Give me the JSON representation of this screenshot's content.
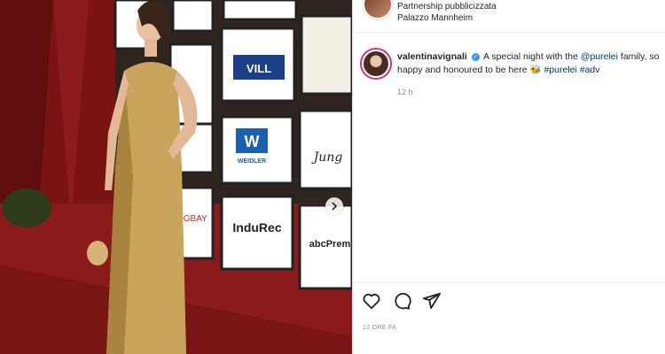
{
  "header": {
    "partnership": "Partnership pubblicizzata",
    "location": "Palazzo Mannheim"
  },
  "post": {
    "username": "valentinavignali",
    "caption_line1_text": "A special night with the",
    "caption_mention": "@purelei",
    "caption_line1_end": "family, so",
    "caption_line2_text": "happy and honoured to be here 🐝",
    "hashtag1": "#purelei",
    "hashtag2": "#adv",
    "relative_time": "12 h",
    "timestamp": "12 ORE FA"
  },
  "media": {
    "sponsor_boards": [
      "VILL",
      "WEIDLER",
      "InduRec",
      "abcPrem",
      "GIGBAY",
      "Jung"
    ]
  },
  "icons": {
    "like": "heart-icon",
    "comment": "comment-icon",
    "share": "share-icon",
    "next": "chevron-right-icon"
  },
  "colors": {
    "link": "#00376b",
    "verified": "#3897f0",
    "carpet": "#8b1a1a"
  }
}
